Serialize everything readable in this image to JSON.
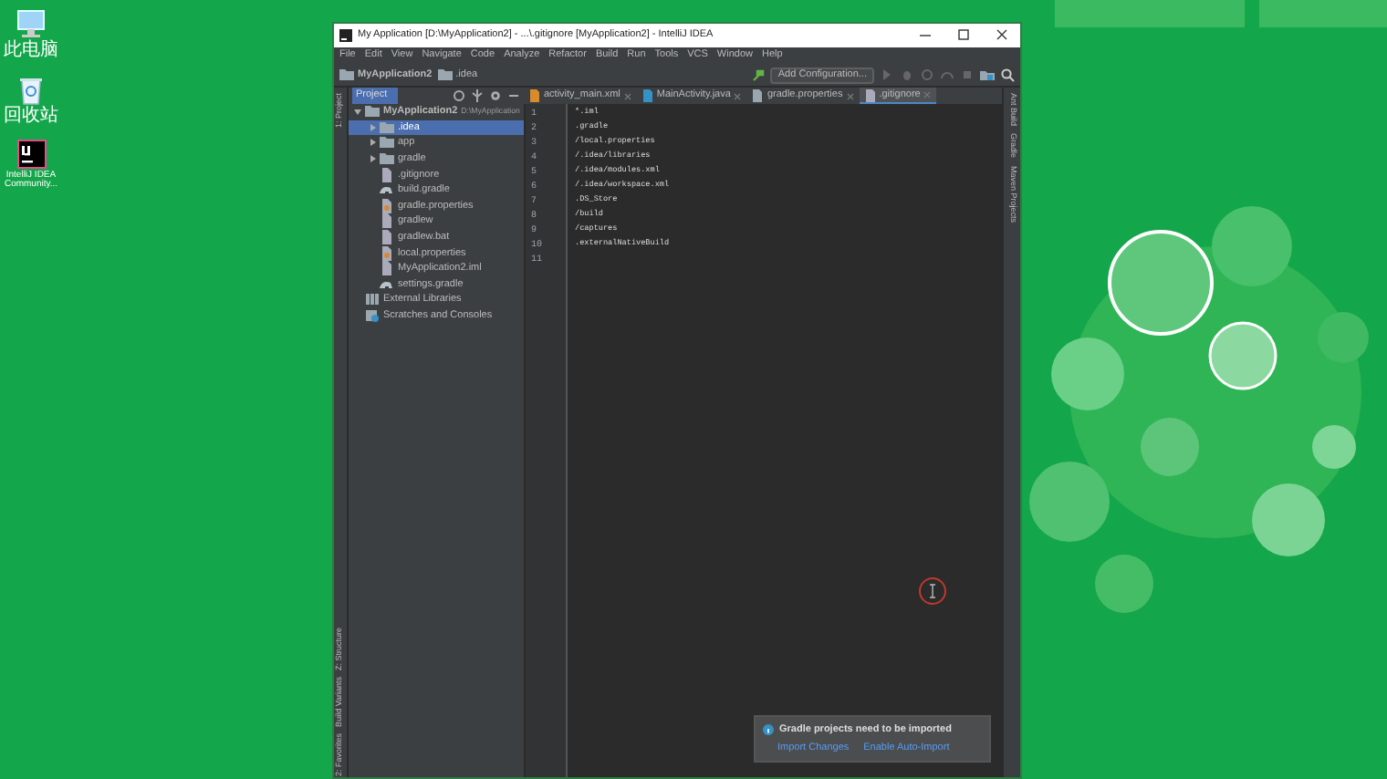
{
  "desktop": {
    "icons": [
      {
        "kind": "computer",
        "label": "此电脑"
      },
      {
        "kind": "recycle",
        "label": "回收站"
      },
      {
        "kind": "ide",
        "label": "IntelliJ IDEA Community..."
      }
    ]
  },
  "window": {
    "title": "My Application [D:\\MyApplication2] - ...\\.gitignore [MyApplication2] - IntelliJ IDEA"
  },
  "menu": [
    "File",
    "Edit",
    "View",
    "Navigate",
    "Code",
    "Analyze",
    "Refactor",
    "Build",
    "Run",
    "Tools",
    "VCS",
    "Window",
    "Help"
  ],
  "breadcrumbs": [
    "MyApplication2",
    ".idea"
  ],
  "run_config": "Add Configuration...",
  "project_panel": {
    "title": "Project",
    "tree": [
      {
        "label": "MyApplication2",
        "path": "D:\\MyApplication",
        "kind": "module",
        "expanded": true,
        "selected": false,
        "children": [
          {
            "label": ".idea",
            "kind": "folder",
            "expanded": false,
            "selected": true
          },
          {
            "label": "app",
            "kind": "folder",
            "expanded": false,
            "selected": false
          },
          {
            "label": "gradle",
            "kind": "folder",
            "expanded": false,
            "selected": false
          },
          {
            "label": ".gitignore",
            "kind": "file",
            "selected": false
          },
          {
            "label": "build.gradle",
            "kind": "gradle",
            "selected": false
          },
          {
            "label": "gradle.properties",
            "kind": "props",
            "selected": false
          },
          {
            "label": "gradlew",
            "kind": "file",
            "selected": false
          },
          {
            "label": "gradlew.bat",
            "kind": "file",
            "selected": false
          },
          {
            "label": "local.properties",
            "kind": "props",
            "selected": false
          },
          {
            "label": "MyApplication2.iml",
            "kind": "file",
            "selected": false
          },
          {
            "label": "settings.gradle",
            "kind": "gradle",
            "selected": false
          }
        ]
      },
      {
        "label": "External Libraries",
        "kind": "library",
        "selected": false
      },
      {
        "label": "Scratches and Consoles",
        "kind": "scratch",
        "selected": false
      }
    ]
  },
  "editor_tabs": [
    {
      "label": "activity_main.xml",
      "kind": "xml",
      "selected": false
    },
    {
      "label": "MainActivity.java",
      "kind": "java",
      "selected": false
    },
    {
      "label": "gradle.properties",
      "kind": "props",
      "selected": false
    },
    {
      "label": ".gitignore",
      "kind": "file",
      "selected": true
    }
  ],
  "code_lines": [
    {
      "number": "1",
      "text": "*.iml"
    },
    {
      "number": "2",
      "text": ".gradle"
    },
    {
      "number": "3",
      "text": "/local.properties"
    },
    {
      "number": "4",
      "text": "/.idea/libraries"
    },
    {
      "number": "5",
      "text": "/.idea/modules.xml"
    },
    {
      "number": "6",
      "text": "/.idea/workspace.xml"
    },
    {
      "number": "7",
      "text": ".DS_Store"
    },
    {
      "number": "8",
      "text": "/build"
    },
    {
      "number": "9",
      "text": "/captures"
    },
    {
      "number": "10",
      "text": ".externalNativeBuild"
    },
    {
      "number": "11"
    }
  ],
  "left_stripe": [
    "1: Project",
    "Z: Structure",
    "Build Variants",
    "2: Favorites"
  ],
  "right_stripe": [
    "Ant Build",
    "Gradle",
    "Maven Projects"
  ],
  "notification": {
    "message": "Gradle projects need to be imported",
    "actions": [
      "Import Changes",
      "Enable Auto-Import"
    ]
  }
}
